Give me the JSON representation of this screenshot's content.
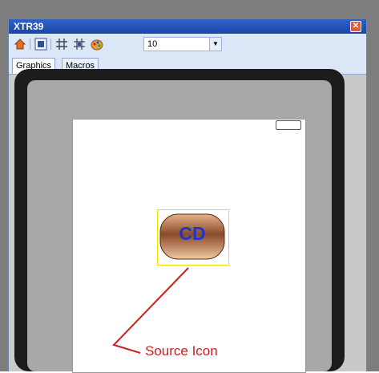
{
  "window": {
    "title": "XTR39"
  },
  "toolbar": {
    "icons": [
      "home-icon",
      "grid-icon",
      "hash-icon",
      "snap-grid-icon",
      "palette-icon"
    ],
    "zoom_value": "10"
  },
  "tabs": [
    {
      "label": "Graphics",
      "active": true
    },
    {
      "label": "Macros",
      "active": false
    }
  ],
  "canvas": {
    "source_icon_text": "CD",
    "annotation": "Source Icon",
    "annotation_color": "#c92020"
  },
  "colors": {
    "title_bar": "#2a5cc2",
    "toolbar_bg": "#dbe6f7",
    "frame": "#1c1c1c",
    "icon_text": "#1c36c8"
  }
}
